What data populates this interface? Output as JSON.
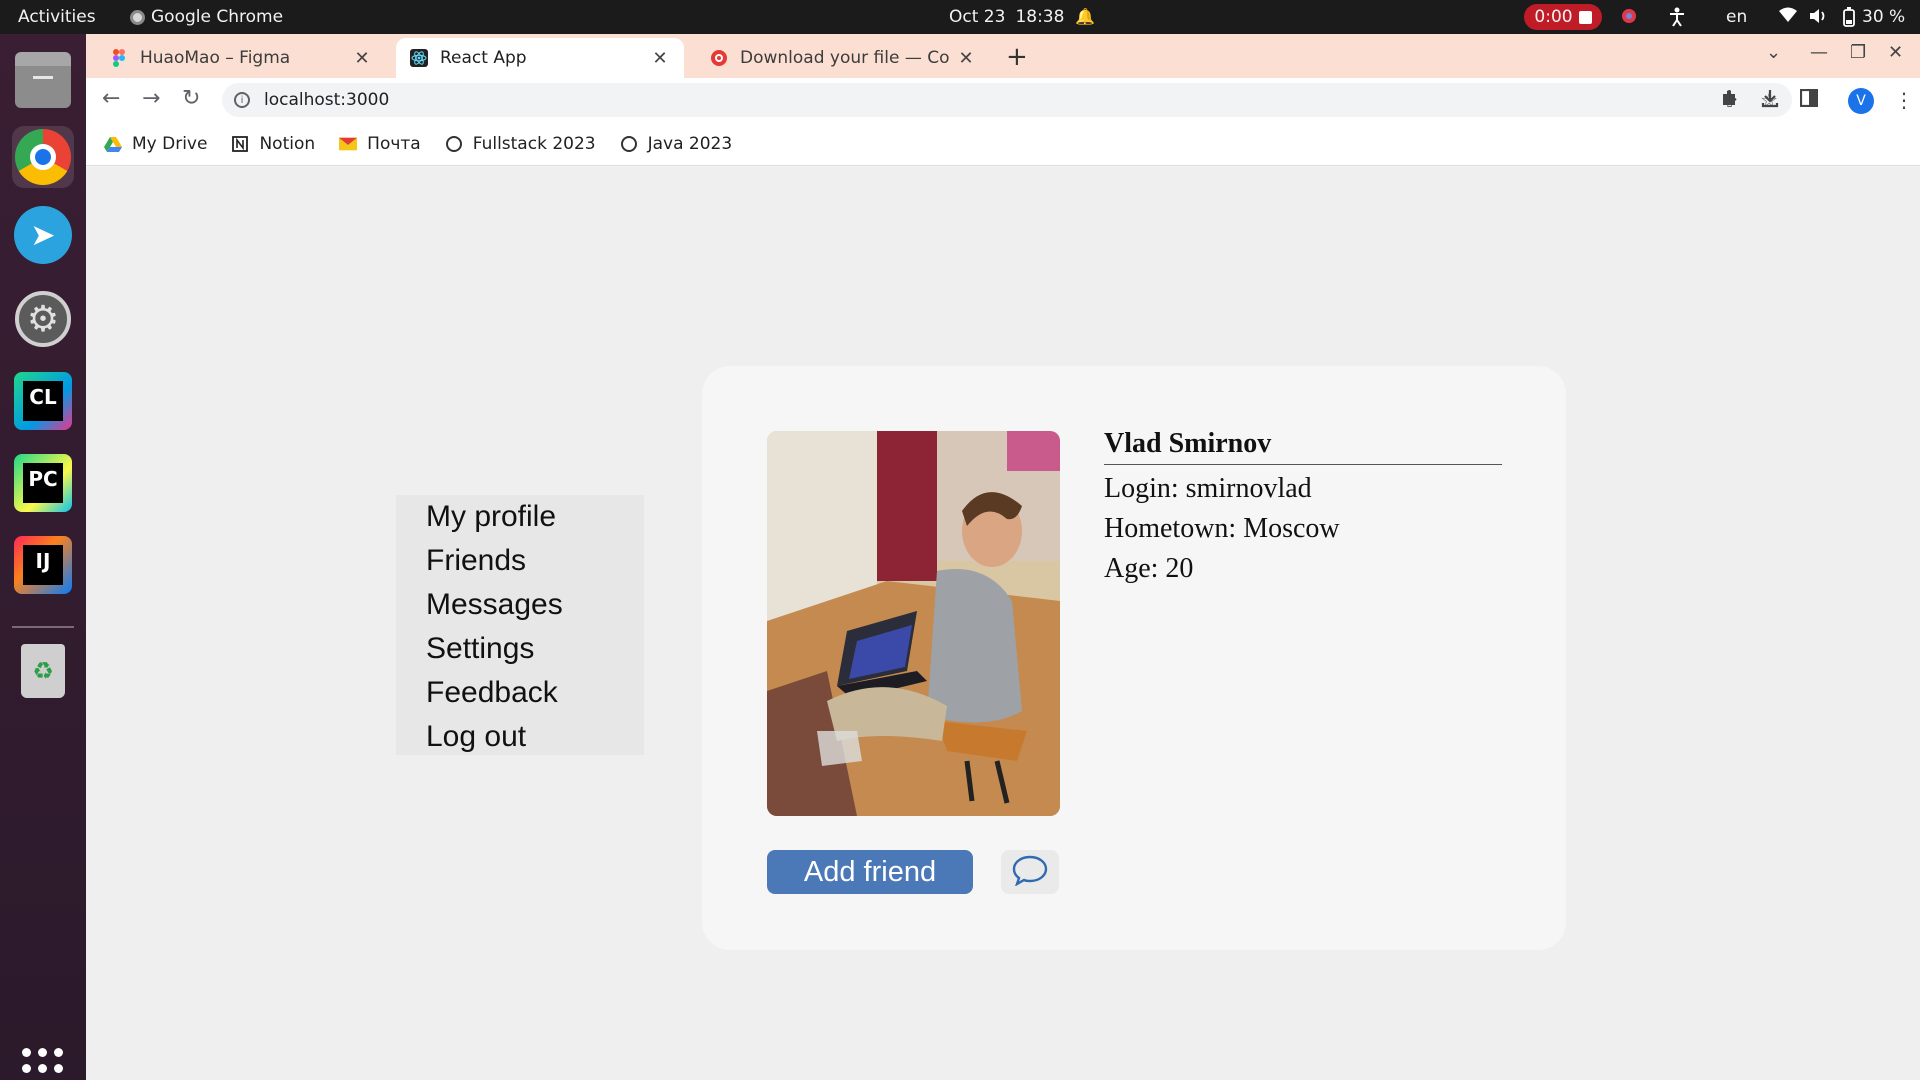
{
  "topbar": {
    "activities": "Activities",
    "app_name": "Google Chrome",
    "date": "Oct 23",
    "time": "18:38",
    "recording": "0:00",
    "language": "en",
    "battery": "30 %"
  },
  "tabs": [
    {
      "title": "HuaoMao – Figma",
      "favicon": "figma-icon"
    },
    {
      "title": "React App",
      "favicon": "react-icon"
    },
    {
      "title": "Download your file — Co",
      "favicon": "download-icon"
    }
  ],
  "address_bar": {
    "url": "localhost:3000"
  },
  "profile_avatar": "V",
  "bookmarks": [
    {
      "label": "My Drive",
      "icon": "drive-icon"
    },
    {
      "label": "Notion",
      "icon": "notion-icon"
    },
    {
      "label": "Почта",
      "icon": "mail-icon"
    },
    {
      "label": "Fullstack 2023",
      "icon": "globe-icon"
    },
    {
      "label": "Java 2023",
      "icon": "globe-icon"
    }
  ],
  "sidebar_menu": {
    "items": [
      "My profile",
      "Friends",
      "Messages",
      "Settings",
      "Feedback",
      "Log out"
    ]
  },
  "profile": {
    "name": "Vlad Smirnov",
    "login": "Login: smirnovlad",
    "hometown": "Hometown: Moscow",
    "age": "Age: 20"
  },
  "actions": {
    "add_friend": "Add friend"
  },
  "colors": {
    "accent_button": "#4b78b7",
    "tabstrip": "#fcdfd3",
    "page_background": "#efefef",
    "card_background": "#f6f6f6",
    "recording_badge": "#c01c28"
  }
}
